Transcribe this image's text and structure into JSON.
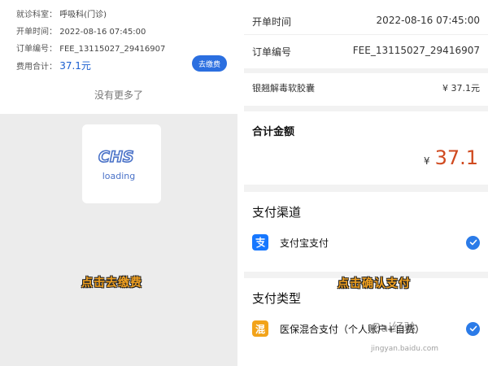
{
  "left": {
    "order": {
      "department_label": "就诊科室：",
      "department_value": "呼吸科(门诊)",
      "time_label": "开单时间：",
      "time_value": "2022-08-16 07:45:00",
      "order_no_label": "订单编号：",
      "order_no_value": "FEE_13115027_29416907",
      "total_label": "费用合计：",
      "total_value": "37.1元",
      "pay_button": "去缴费"
    },
    "no_more": "没有更多了",
    "loading": {
      "logo": "CHS",
      "text": "loading"
    },
    "caption": "点击去缴费"
  },
  "right": {
    "info": {
      "time_label": "开单时间",
      "time_value": "2022-08-16 07:45:00",
      "order_no_label": "订单编号",
      "order_no_value": "FEE_13115027_29416907"
    },
    "drug": {
      "name": "银翘解毒软胶囊",
      "price": "¥ 37.1元"
    },
    "total": {
      "title": "合计金额",
      "currency": "¥",
      "amount": "37.1"
    },
    "channel": {
      "title": "支付渠道",
      "option": "支付宝支付",
      "icon": "alipay-icon"
    },
    "type": {
      "title": "支付类型",
      "option": "医保混合支付（个人账户+自费）",
      "icon_char": "混"
    },
    "caption": "点击确认支付",
    "watermark": "Bai经验",
    "watermark_url": "jingyan.baidu.com"
  },
  "colors": {
    "accent_blue": "#2b6fe0",
    "amount_red": "#d04a20",
    "caption_orange": "#f0a020",
    "alipay_blue": "#1677ff",
    "mix_orange": "#f2a31a"
  }
}
